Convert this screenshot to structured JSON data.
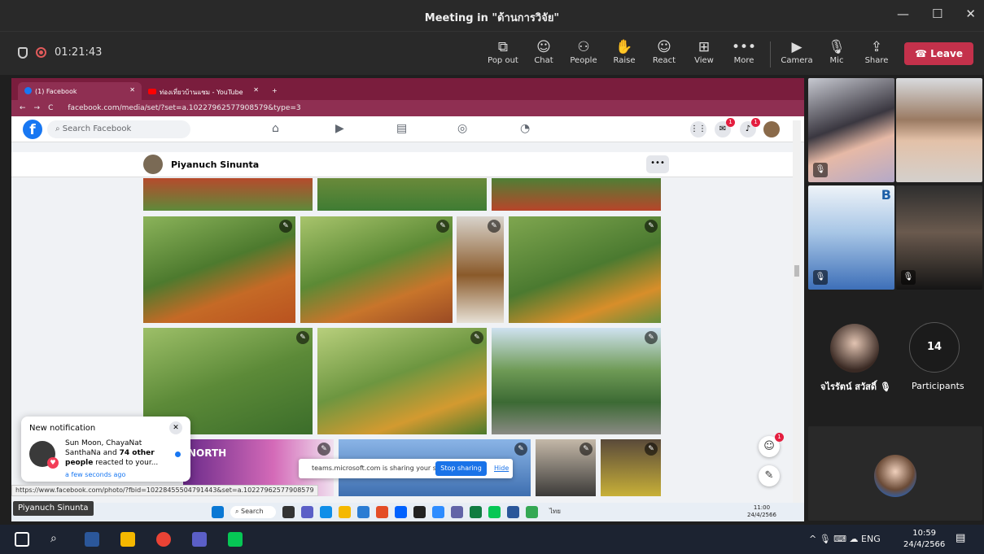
{
  "window": {
    "title": "Meeting in \"ด้านการวิจัย\"",
    "controls": [
      "—",
      "☐",
      "✕"
    ]
  },
  "toolbar": {
    "timer": "01:21:43",
    "buttons": [
      {
        "label": "Pop out",
        "icon": "pop-out-icon",
        "glyph": "⧉"
      },
      {
        "label": "Chat",
        "icon": "chat-icon",
        "glyph": "☺"
      },
      {
        "label": "People",
        "icon": "people-icon",
        "glyph": "⚇"
      },
      {
        "label": "Raise",
        "icon": "raise-hand-icon",
        "glyph": "✋"
      },
      {
        "label": "React",
        "icon": "react-icon",
        "glyph": "☺"
      },
      {
        "label": "View",
        "icon": "view-icon",
        "glyph": "⊞"
      },
      {
        "label": "More",
        "icon": "more-icon",
        "glyph": "•••"
      },
      {
        "label": "Camera",
        "icon": "camera-off-icon",
        "glyph": "▶"
      },
      {
        "label": "Mic",
        "icon": "mic-off-icon",
        "glyph": "🎙"
      },
      {
        "label": "Share",
        "icon": "share-icon",
        "glyph": "⇪"
      }
    ],
    "leave": "Leave",
    "leave_color": "#c4314b"
  },
  "browser": {
    "tabs": [
      {
        "label": "(1) Facebook",
        "close": "✕"
      },
      {
        "label": "ท่องเที่ยวบ้านแซม - YouTube",
        "close": "✕"
      }
    ],
    "new_tab": "+",
    "url": "facebook.com/media/set/?set=a.10227962577908579&type=3",
    "nav": [
      "←",
      "→",
      "C"
    ]
  },
  "facebook": {
    "search_placeholder": "Search Facebook",
    "messenger_badge": "1",
    "notifications_badge": "1",
    "profile_initial": "P",
    "user_name": "Piyanuch Sinunta",
    "more": "•••",
    "notification": {
      "heading": "New notification",
      "text_line1": "Sun Moon, ChayaNat",
      "text_line2": "SanthaNa and",
      "count": "74 other",
      "text_line3": "people",
      "text_line4": "reacted to your...",
      "ago": "a few seconds ago"
    },
    "banner_text": "NORTH",
    "fab_badge": "1",
    "status_url": "https://www.facebook.com/photo/?fbid=10228455504791443&set=a.10227962577908579"
  },
  "share_notice": {
    "text": "teams.microsoft.com is sharing your screen.",
    "stop": "Stop sharing",
    "hide": "Hide"
  },
  "presenter_label": "Piyanuch Sinunta",
  "inner_taskbar": {
    "search": "Search",
    "time": "11:00",
    "date": "24/4/2566",
    "lang": "ไทย"
  },
  "participants": {
    "tile_letter": "B",
    "named_participant": "จไรรัตน์ สวัสดิ์",
    "count": "14",
    "count_label": "Participants"
  },
  "taskbar": {
    "time": "10:59",
    "date": "24/4/2566",
    "lang": "ENG"
  }
}
